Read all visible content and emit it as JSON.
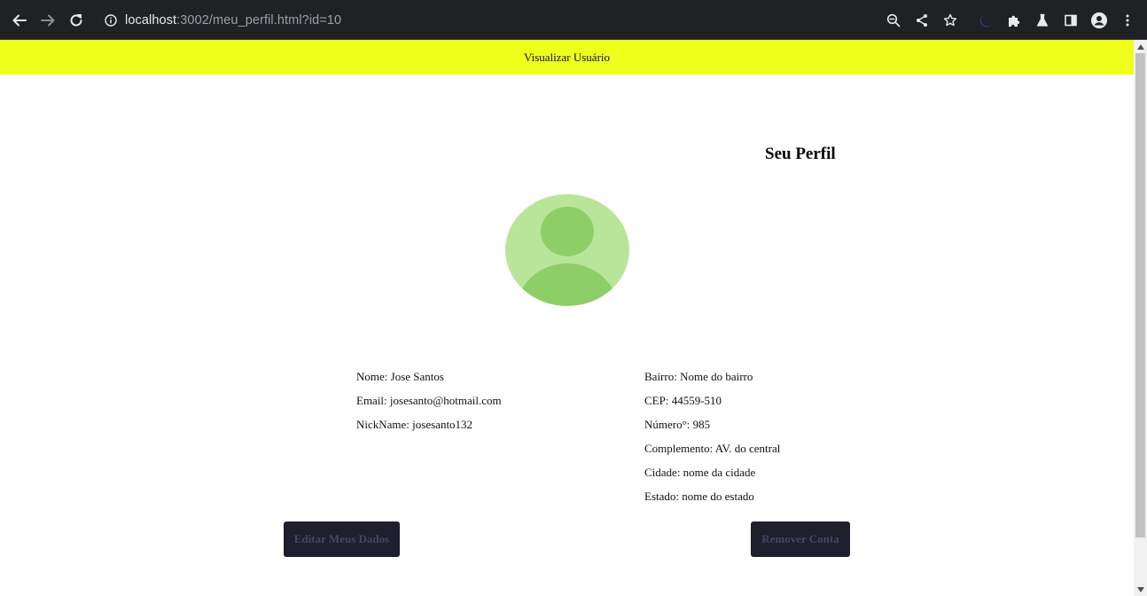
{
  "browser": {
    "url_host": "localhost",
    "url_rest": ":3002/meu_perfil.html?id=10",
    "icons": [
      "back-icon",
      "forward-icon",
      "reload-icon",
      "info-icon",
      "zoom-icon",
      "share-icon",
      "star-icon",
      "moon-icon",
      "extensions-icon",
      "labs-icon",
      "sidepanel-icon",
      "profile-icon",
      "menu-icon"
    ]
  },
  "header": {
    "title": "Visualizar Usuário"
  },
  "page": {
    "title": "Seu Perfil"
  },
  "avatar": {
    "icon": "user-avatar-icon",
    "bg_color": "#b9e59a",
    "fg_color": "#8ece66"
  },
  "user_info": [
    {
      "text": "Nome: Jose Santos"
    },
    {
      "text": "Email: josesanto@hotmail.com"
    },
    {
      "text": "NickName: josesanto132"
    }
  ],
  "address_info": [
    {
      "text": "Bairro: Nome do bairro"
    },
    {
      "text": "CEP: 44559-510"
    },
    {
      "text": "Número°: 985"
    },
    {
      "text": "Complemento: AV. do central"
    },
    {
      "text": "Cidade: nome da cidade"
    },
    {
      "text": "Estado: nome do estado"
    }
  ],
  "buttons": {
    "edit": "Editar Meus Dados",
    "remove": "Remover Conta"
  },
  "colors": {
    "header": "#eeff1b",
    "button_bg": "#1f1f2e",
    "button_text": "#45456a"
  }
}
